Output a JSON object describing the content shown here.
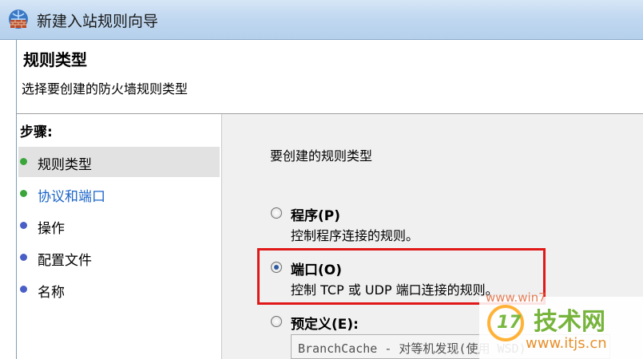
{
  "window": {
    "title": "新建入站规则向导"
  },
  "header": {
    "title": "规则类型",
    "description": "选择要创建的防火墙规则类型"
  },
  "steps": {
    "header": "步骤:",
    "items": [
      {
        "label": "规则类型",
        "dot_color": "#3aa63a"
      },
      {
        "label": "协议和端口",
        "dot_color": "#3aa63a"
      },
      {
        "label": "操作",
        "dot_color": "#4a5ec8"
      },
      {
        "label": "配置文件",
        "dot_color": "#4a5ec8"
      },
      {
        "label": "名称",
        "dot_color": "#4a5ec8"
      }
    ]
  },
  "main": {
    "prompt": "要创建的规则类型",
    "options": [
      {
        "title": "程序(P)",
        "description": "控制程序连接的规则。",
        "checked": false
      },
      {
        "title": "端口(O)",
        "description": "控制 TCP 或 UDP 端口连接的规则。",
        "checked": true
      },
      {
        "title": "预定义(E):",
        "description": "",
        "checked": false
      }
    ],
    "predefined_value": "BranchCache - 对等机发现(使用 WSD)"
  },
  "watermark": {
    "brand": "技术网",
    "url": "www.itjs.cn",
    "logo_number": "17",
    "faint": "www.win7"
  },
  "colors": {
    "highlight": "#e01818",
    "link": "#1b64c8",
    "accent": "#2d5aa0"
  }
}
